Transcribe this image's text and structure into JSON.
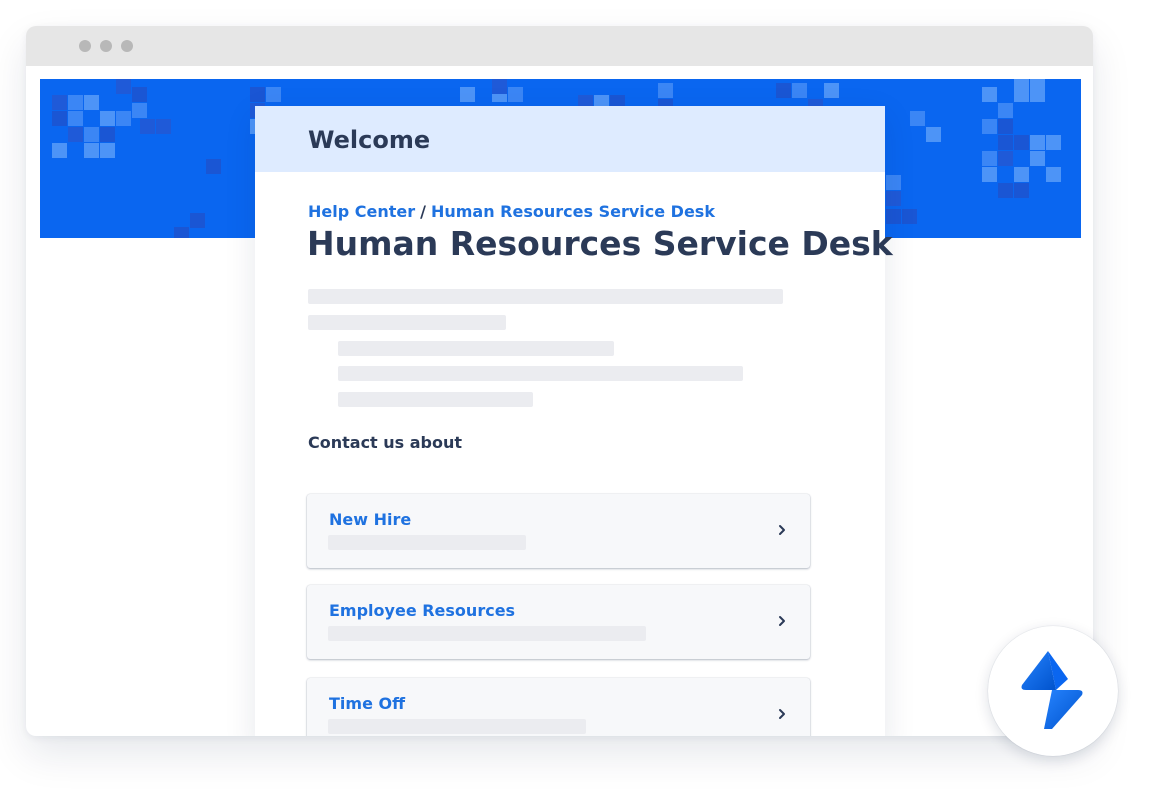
{
  "window": {
    "controls": [
      "close",
      "minimize",
      "maximize"
    ]
  },
  "header": {
    "title": "Welcome"
  },
  "breadcrumb": {
    "home": "Help Center",
    "separator": "/",
    "current": "Human Resources Service Desk"
  },
  "page": {
    "title": "Human Resources Service Desk"
  },
  "contact": {
    "label": "Contact us about",
    "items": [
      {
        "label": "New Hire"
      },
      {
        "label": "Employee Resources"
      },
      {
        "label": "Time Off"
      }
    ]
  },
  "icons": {
    "request_arrow": "chevron-right-icon",
    "brand": "jira-service-management-logo"
  },
  "colors": {
    "brand_blue": "#0a66f0",
    "link": "#1f72e0",
    "text": "#2b3a57",
    "header_bg": "#deebff",
    "skeleton": "#ebecf0"
  }
}
